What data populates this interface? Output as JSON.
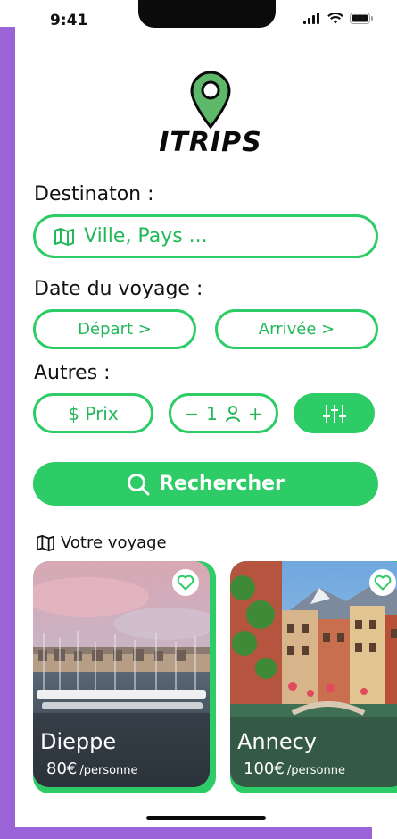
{
  "status": {
    "time": "9:41"
  },
  "logo": {
    "text": "ITRIPS"
  },
  "destination": {
    "label": "Destinaton :",
    "placeholder": "Ville, Pays ..."
  },
  "dates": {
    "label": "Date du voyage :",
    "depart": "Départ >",
    "arrivee": "Arrivée >"
  },
  "others": {
    "label": "Autres :",
    "price_label": "$ Prix",
    "count": "1",
    "minus": "−",
    "plus": "+"
  },
  "search": {
    "label": "Rechercher"
  },
  "trips": {
    "title": "Votre voyage",
    "items": [
      {
        "city": "Dieppe",
        "price": "80€",
        "unit": "/personne"
      },
      {
        "city": "Annecy",
        "price": "100€",
        "unit": "/personne"
      }
    ]
  },
  "colors": {
    "accent": "#2ecc66",
    "frame": "#9b63d8"
  }
}
